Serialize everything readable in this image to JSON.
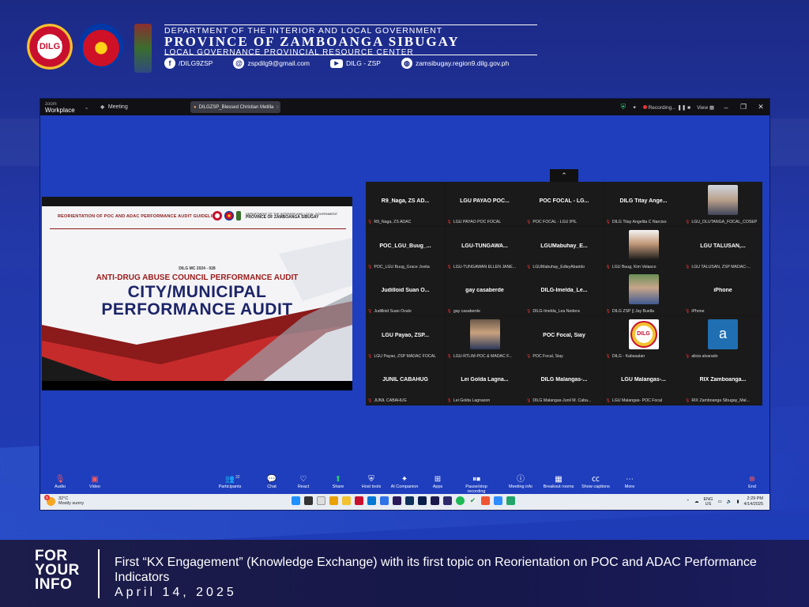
{
  "header": {
    "org_line1": "DEPARTMENT OF THE INTERIOR AND LOCAL GOVERNMENT",
    "org_line2": "PROVINCE OF ZAMBOANGA SIBUGAY",
    "org_line3": "LOCAL GOVERNANCE PROVINCIAL RESOURCE CENTER",
    "logo_text": "DILG",
    "contacts": [
      {
        "icon": "facebook-icon",
        "glyph": "f",
        "text": "/DILG9ZSP"
      },
      {
        "icon": "email-icon",
        "glyph": "@",
        "text": "zspdilg9@gmail.com"
      },
      {
        "icon": "youtube-icon",
        "glyph": "▶",
        "text": "DILG - ZSP"
      },
      {
        "icon": "globe-icon",
        "glyph": "◍",
        "text": "zamsibugay.region9.dilg.gov.ph"
      }
    ]
  },
  "zoom": {
    "brand_small": "zoom",
    "brand_big": "Workplace",
    "meeting_label": "Meeting",
    "tab_label": "DILGZSP_Blessed Christian Metilla",
    "recording_label": "Recording...",
    "view_label": "View",
    "collapse_glyph": "⌃"
  },
  "slide": {
    "header_text": "REORIENTATION OF POC AND ADAC PERFORMANCE AUDIT GUIDELINES",
    "org_line1": "DEPARTMENT OF THE INTERIOR AND LOCAL GOVERNMENT",
    "org_line2": "PROVINCE OF ZAMBOANGA SIBUGAY",
    "mc_text": "DILG MC 2024 - 028",
    "subtitle": "ANTI-DRUG ABUSE COUNCIL PERFORMANCE AUDIT",
    "title_line1": "CITY/MUNICIPAL",
    "title_line2": "PERFORMANCE AUDIT"
  },
  "gallery": [
    {
      "name": "R9_Naga, ZS AD...",
      "label": "R9_Naga, ZS ADAC",
      "photo": ""
    },
    {
      "name": "LGU PAYAO POC...",
      "label": "LGU PAYAO POC FOCAL",
      "photo": ""
    },
    {
      "name": "POC FOCAL - LG...",
      "label": "POC FOCAL - LGU IPIL",
      "photo": ""
    },
    {
      "name": "DILG Titay Ange...",
      "label": "DILG Titay Angelita C Narciso",
      "photo": ""
    },
    {
      "name": "",
      "label": "LGU_OLUTANGA_FOCAL_COSEP",
      "photo": "ph-photo"
    },
    {
      "name": "POC_LGU_Buug_...",
      "label": "POC_LGU Buug_Grace Jovita",
      "photo": ""
    },
    {
      "name": "LGU-TUNGAWA...",
      "label": "LGU-TUNGAWAN ELLEN JANE...",
      "photo": ""
    },
    {
      "name": "LGUMabuhay_E...",
      "label": "LGUMabuhay_EdleyAbarido",
      "photo": ""
    },
    {
      "name": "",
      "label": "LGU Buug, Kim Velasco",
      "photo": "ph-photo2"
    },
    {
      "name": "LGU TALUSAN,...",
      "label": "LGU TALUSAN, ZSP MADAC-...",
      "photo": ""
    },
    {
      "name": "Judilloid Suan O...",
      "label": "Judilloid Suan Ovalo",
      "photo": ""
    },
    {
      "name": "gay casaberde",
      "label": "gay casaberde",
      "photo": ""
    },
    {
      "name": "DILG-Imelda_Le...",
      "label": "DILG-Imelda_Lea Nedera",
      "photo": ""
    },
    {
      "name": "",
      "label": "DILG ZSP || Jay Buella",
      "photo": "ph-photo3"
    },
    {
      "name": "iPhone",
      "label": "iPhone",
      "photo": ""
    },
    {
      "name": "LGU Payao, ZSP...",
      "label": "LGU Payao, ZSP MADAC FOCAL",
      "photo": ""
    },
    {
      "name": "",
      "label": "LGU-RTLIM-POC & MADAC F...",
      "photo": "ph-photo4"
    },
    {
      "name": "POC Focal, Siay",
      "label": "POC Focal, Siay",
      "photo": ""
    },
    {
      "name": "",
      "label": "DILG - Kabasalan",
      "photo": "ph-dilg"
    },
    {
      "name": "",
      "label": "alicia alvarado",
      "photo": "ph-avatar",
      "avatar_letter": "a"
    },
    {
      "name": "JUNIL CABAHUG",
      "label": "JUNIL CABAHUG",
      "photo": ""
    },
    {
      "name": "Lei Golda Lagna...",
      "label": "Lei Golda Lagnason",
      "photo": ""
    },
    {
      "name": "DILG Malangas-...",
      "label": "DILG Malangas-Junil M. Caba...",
      "photo": ""
    },
    {
      "name": "LGU Malangas-...",
      "label": "LGU Malangas- POC Focal",
      "photo": ""
    },
    {
      "name": "RIX Zamboanga...",
      "label": "RIX Zamboanga Sibugay_Mal...",
      "photo": ""
    }
  ],
  "toolbar": {
    "audio": "Audio",
    "video": "Video",
    "participants": "Participants",
    "participants_count": "32",
    "chat": "Chat",
    "react": "React",
    "share": "Share",
    "host_tools": "Host tools",
    "ai_companion": "AI Companion",
    "apps": "Apps",
    "pause_recording": "Pause/stop recording",
    "meeting_info": "Meeting info",
    "breakout": "Breakout rooms",
    "captions": "Show captions",
    "more": "More",
    "end": "End"
  },
  "taskbar": {
    "temp": "32°C",
    "weather": "Mostly sunny",
    "weather_badge": "1",
    "lang1": "ENG",
    "lang2": "US",
    "time": "2:29 PM",
    "date": "4/14/2025"
  },
  "caption": {
    "fyi_line1": "FOR",
    "fyi_line2": "YOUR",
    "fyi_line3": "INFO",
    "title": "First “KX Engagement” (Knowledge Exchange) with its first topic on Reorientation on POC and ADAC Performance Indicators",
    "date": "April 14, 2025"
  },
  "colors": {
    "frame_blue": "#2338a8",
    "zoom_stage": "#1e3ebd",
    "slide_title": "#1c2468",
    "slide_red": "#9b1b1b",
    "caption_bg": "#16174a"
  }
}
